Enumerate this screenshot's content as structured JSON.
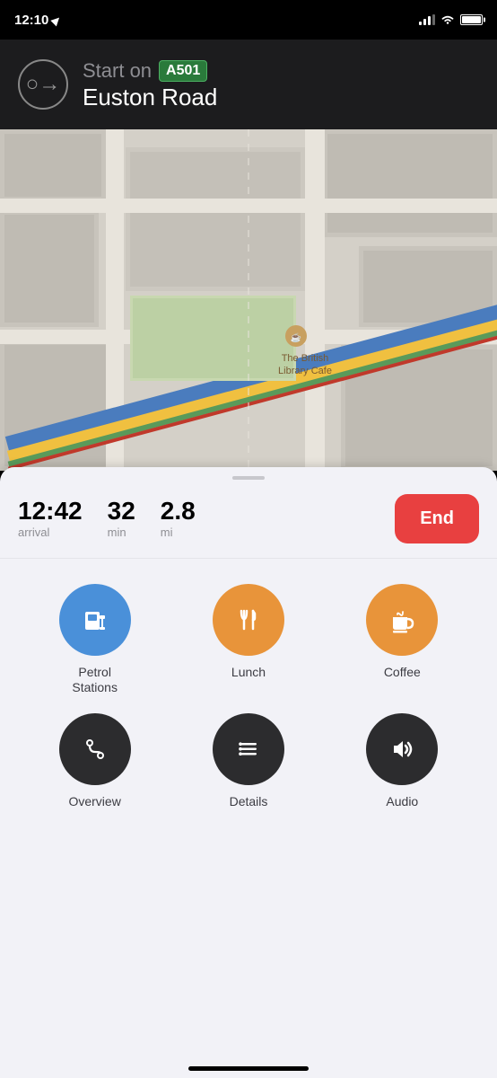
{
  "statusBar": {
    "time": "12:10",
    "locationArrow": "▶"
  },
  "navHeader": {
    "startOnLabel": "Start on",
    "roadBadge": "A501",
    "roadName": "Euston Road"
  },
  "mapLabel": "The British Library Cafe",
  "eta": {
    "arrivalTime": "12:42",
    "arrivalLabel": "arrival",
    "minutes": "32",
    "minutesLabel": "min",
    "distance": "2.8",
    "distanceLabel": "mi"
  },
  "endButton": "End",
  "actions": {
    "row1": [
      {
        "id": "petrol",
        "label": "Petrol\nStations",
        "color": "blue",
        "icon": "⛽"
      },
      {
        "id": "lunch",
        "label": "Lunch",
        "color": "orange",
        "icon": "🍴"
      },
      {
        "id": "coffee",
        "label": "Coffee",
        "color": "orange",
        "icon": "☕"
      }
    ],
    "row2": [
      {
        "id": "overview",
        "label": "Overview",
        "color": "dark",
        "icon": "〰"
      },
      {
        "id": "details",
        "label": "Details",
        "color": "dark",
        "icon": "≡"
      },
      {
        "id": "audio",
        "label": "Audio",
        "color": "dark",
        "icon": "🔊"
      }
    ]
  }
}
